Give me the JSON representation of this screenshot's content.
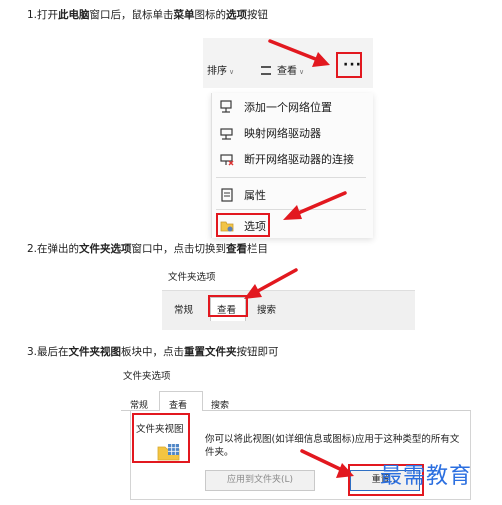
{
  "steps": [
    {
      "prefix": "1.打开",
      "b1": "此电脑",
      "mid1": "窗口后，鼠标单击",
      "b2": "菜单",
      "mid2": "图标的",
      "b3": "选项",
      "suffix": "按钮"
    },
    {
      "prefix": "2.在弹出的",
      "b1": "文件夹选项",
      "mid1": "窗口中，点击切换到",
      "b2": "查看",
      "suffix": "栏目"
    },
    {
      "prefix": "3.最后在",
      "b1": "文件夹视图",
      "mid1": "板块中，点击",
      "b2": "重置文件夹",
      "suffix": "按钮即可"
    }
  ],
  "shot1": {
    "sort_label": "排序",
    "view_label": "查看",
    "more_label": "···",
    "menu_items": [
      "添加一个网络位置",
      "映射网络驱动器",
      "断开网络驱动器的连接",
      "属性",
      "选项"
    ]
  },
  "shot2": {
    "title": "文件夹选项",
    "tabs": [
      "常规",
      "查看",
      "搜索"
    ]
  },
  "shot3": {
    "title": "文件夹选项",
    "tabs": [
      "常规",
      "查看",
      "搜索"
    ],
    "section_label": "文件夹视图",
    "description": "你可以将此视图(如详细信息或图标)应用于这种类型的所有文件夹。",
    "apply_button": "应用到文件夹(L)",
    "reset_button": "重置..."
  },
  "watermark": "最需教育",
  "colors": {
    "highlight": "#e2181f",
    "watermark": "#2b6fe0",
    "primary_border": "#2f6fc4"
  }
}
